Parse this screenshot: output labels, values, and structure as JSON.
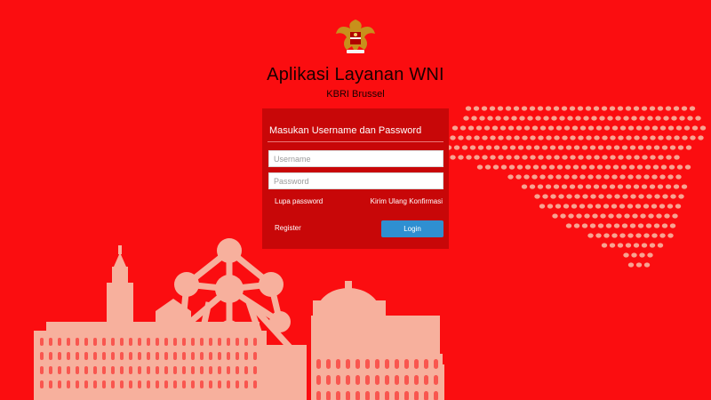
{
  "header": {
    "emblem_icon": "garuda-emblem-icon",
    "title": "Aplikasi Layanan WNI",
    "subtitle": "KBRI Brussel"
  },
  "login": {
    "heading": "Masukan Username dan Password",
    "username_placeholder": "Username",
    "password_placeholder": "Password",
    "forgot_password": "Lupa password",
    "resend_confirmation": "Kirim Ulang Konfirmasi",
    "register": "Register",
    "login_button": "Login"
  },
  "colors": {
    "background": "#fb0d10",
    "panel": "#c80708",
    "illustration": "#f7b09d",
    "button": "#2f8fd1"
  },
  "illustration": {
    "skyline_icon": "brussels-skyline-icon",
    "map_icon": "belgium-dot-map-icon"
  }
}
